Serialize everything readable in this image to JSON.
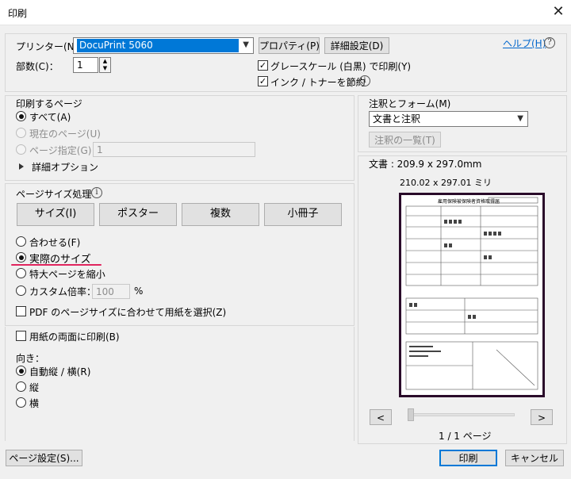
{
  "window": {
    "title": "印刷",
    "close_glyph": "✕"
  },
  "printer": {
    "label": "プリンター(N)：",
    "selected": "DocuPrint 5060",
    "properties_button": "プロパティ(P)",
    "advanced_button": "詳細設定(D)",
    "help_link": "ヘルプ(H)",
    "copies_label": "部数(C)：",
    "copies_value": "1",
    "grayscale_label": "グレースケール (白黒) で印刷(Y)",
    "grayscale_checked": true,
    "save_ink_label": "インク / トナーを節約",
    "save_ink_checked": true
  },
  "pages_to_print": {
    "heading": "印刷するページ",
    "all": "すべて(A)",
    "current": "現在のページ(U)",
    "range": "ページ指定(G)",
    "range_value": "1",
    "more_options": "詳細オプション"
  },
  "page_sizing": {
    "heading": "ページサイズ処理",
    "tabs": [
      "サイズ(I)",
      "ポスター",
      "複数",
      "小冊子"
    ],
    "fit": "合わせる(F)",
    "actual_size": "実際のサイズ",
    "shrink": "特大ページを縮小",
    "custom_scale": "カスタム倍率：",
    "custom_scale_value": "100",
    "percent": "%",
    "choose_paper": "PDF のページサイズに合わせて用紙を選択(Z)"
  },
  "duplex": {
    "label": "用紙の両面に印刷(B)"
  },
  "orientation": {
    "heading": "向き：",
    "auto": "自動縦 / 横(R)",
    "portrait": "縦",
    "landscape": "横"
  },
  "comments": {
    "heading": "注釈とフォーム(M)",
    "selected": "文書と注釈",
    "summarize_button": "注釈の一覧(T)"
  },
  "preview": {
    "document_size": "文書 : 209.9 x 297.0mm",
    "paper_size": "210.02 x 297.01 ミリ",
    "doc_title": "雇用保険被保険者資格取得届",
    "prev": "<",
    "next": ">",
    "page_indicator": "1 / 1 ページ"
  },
  "footer": {
    "page_setup": "ページ設定(S)...",
    "print": "印刷",
    "cancel": "キャンセル"
  },
  "colors": {
    "accent": "#0078d7",
    "underline_annotation": "#e0245e",
    "selected_printer_bg": "#0078d7"
  }
}
